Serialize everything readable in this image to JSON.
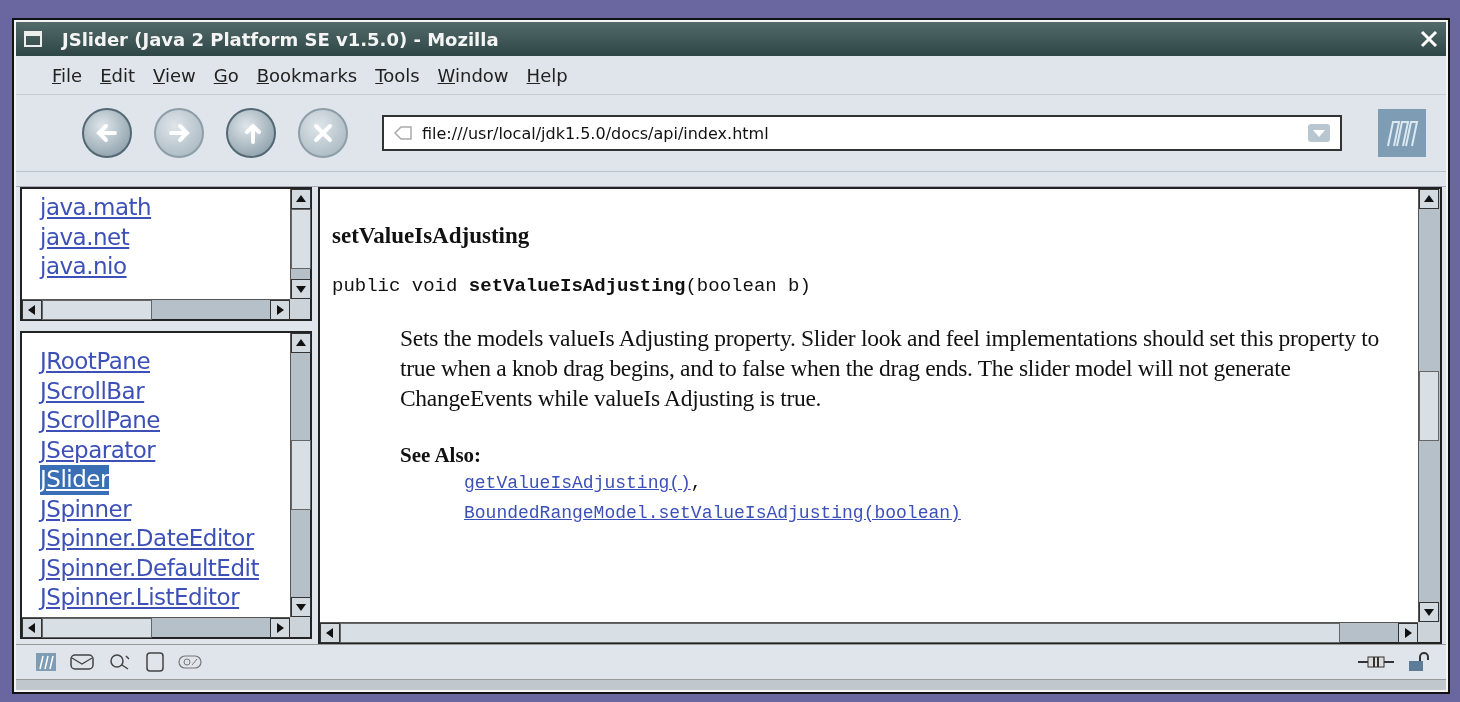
{
  "window": {
    "title": "JSlider (Java 2 Platform SE v1.5.0) - Mozilla"
  },
  "menu": [
    {
      "label": "File"
    },
    {
      "label": "Edit"
    },
    {
      "label": "View"
    },
    {
      "label": "Go"
    },
    {
      "label": "Bookmarks"
    },
    {
      "label": "Tools"
    },
    {
      "label": "Window"
    },
    {
      "label": "Help"
    }
  ],
  "toolbar": {
    "buttons": [
      {
        "kind": "back",
        "disabled": false
      },
      {
        "kind": "forward",
        "disabled": true
      },
      {
        "kind": "reload",
        "disabled": false
      },
      {
        "kind": "stop",
        "disabled": true
      }
    ],
    "url": "file:///usr/local/jdk1.5.0/docs/api/index.html"
  },
  "packages": [
    "java.math",
    "java.net",
    "java.nio"
  ],
  "classes": [
    {
      "label": "JRootPane",
      "selected": false
    },
    {
      "label": "JScrollBar",
      "selected": false
    },
    {
      "label": "JScrollPane",
      "selected": false
    },
    {
      "label": "JSeparator",
      "selected": false
    },
    {
      "label": "JSlider",
      "selected": true
    },
    {
      "label": "JSpinner",
      "selected": false
    },
    {
      "label": "JSpinner.DateEditor",
      "selected": false
    },
    {
      "label": "JSpinner.DefaultEdit",
      "selected": false
    },
    {
      "label": "JSpinner.ListEditor",
      "selected": false
    }
  ],
  "doc": {
    "heading": "setValueIsAdjusting",
    "signature": "public void **setValueIsAdjusting**(boolean b)",
    "description": "Sets the models valueIs Adjusting property. Slider look and feel implementations should set this property to true when a knob drag begins, and to false when the drag ends. The slider model will not generate ChangeEvents while valueIs Adjusting is true.",
    "see_also_label": "See Also:",
    "see_also": [
      "getValueIsAdjusting()",
      "BoundedRangeModel.setValueIsAdjusting(boolean)"
    ],
    "see_also_separator": ","
  }
}
